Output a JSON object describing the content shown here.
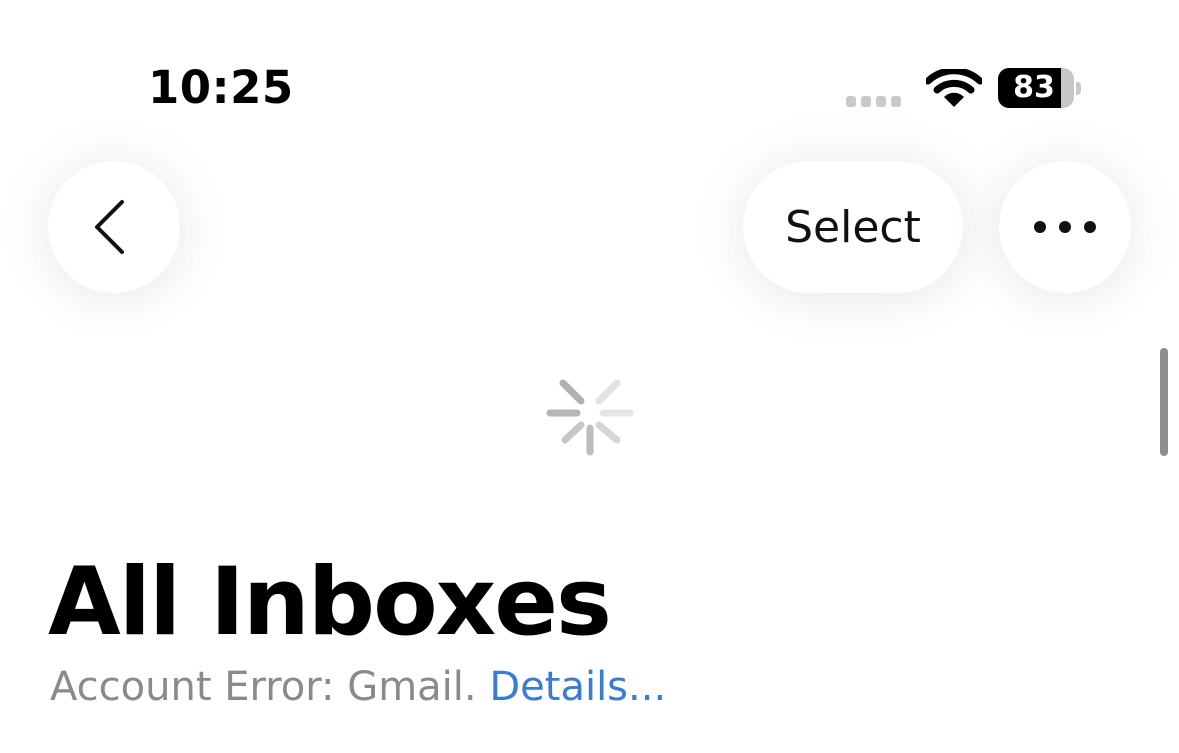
{
  "status_bar": {
    "time": "10:25",
    "battery_percent": "83",
    "battery_level": 0.83,
    "signal_icon": "cellular-signal-icon",
    "wifi_icon": "wifi-icon"
  },
  "nav": {
    "back_icon": "chevron-left-icon",
    "select_label": "Select",
    "more_icon": "ellipsis-icon"
  },
  "loading": {
    "icon": "activity-spinner-icon"
  },
  "header": {
    "title": "All Inboxes",
    "error_text": "Account Error: Gmail.",
    "details_link": "Details..."
  },
  "colors": {
    "link": "#3a7bd5",
    "secondary_text": "#8a8a8e"
  }
}
